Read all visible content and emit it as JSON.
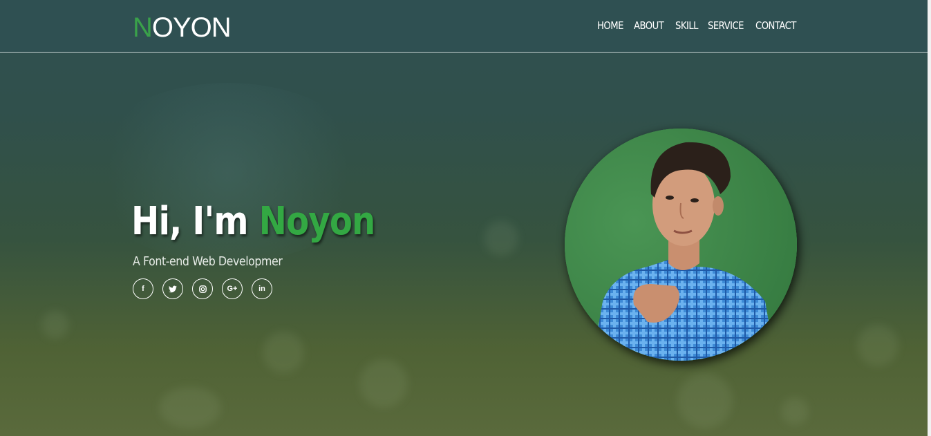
{
  "logo": {
    "first_letter": "N",
    "rest": "OYON"
  },
  "nav": {
    "items": [
      {
        "label": "HOME"
      },
      {
        "label": "ABOUT"
      },
      {
        "label": "SKILL"
      },
      {
        "label": "SERVICE"
      },
      {
        "label": "CONTACT"
      }
    ]
  },
  "hero": {
    "greeting": "Hi, I'm",
    "name": "Noyon",
    "subtitle": "A Font-end Web Developmer",
    "socials": [
      {
        "icon": "facebook-icon",
        "glyph": "f"
      },
      {
        "icon": "twitter-icon",
        "glyph": "t"
      },
      {
        "icon": "instagram-icon",
        "glyph": "◎"
      },
      {
        "icon": "google-plus-icon",
        "glyph": "G+"
      },
      {
        "icon": "linkedin-icon",
        "glyph": "in"
      }
    ]
  },
  "colors": {
    "accent": "#33a843",
    "navbar": "#2f5052",
    "avatar_background": "#3f8a4a"
  }
}
